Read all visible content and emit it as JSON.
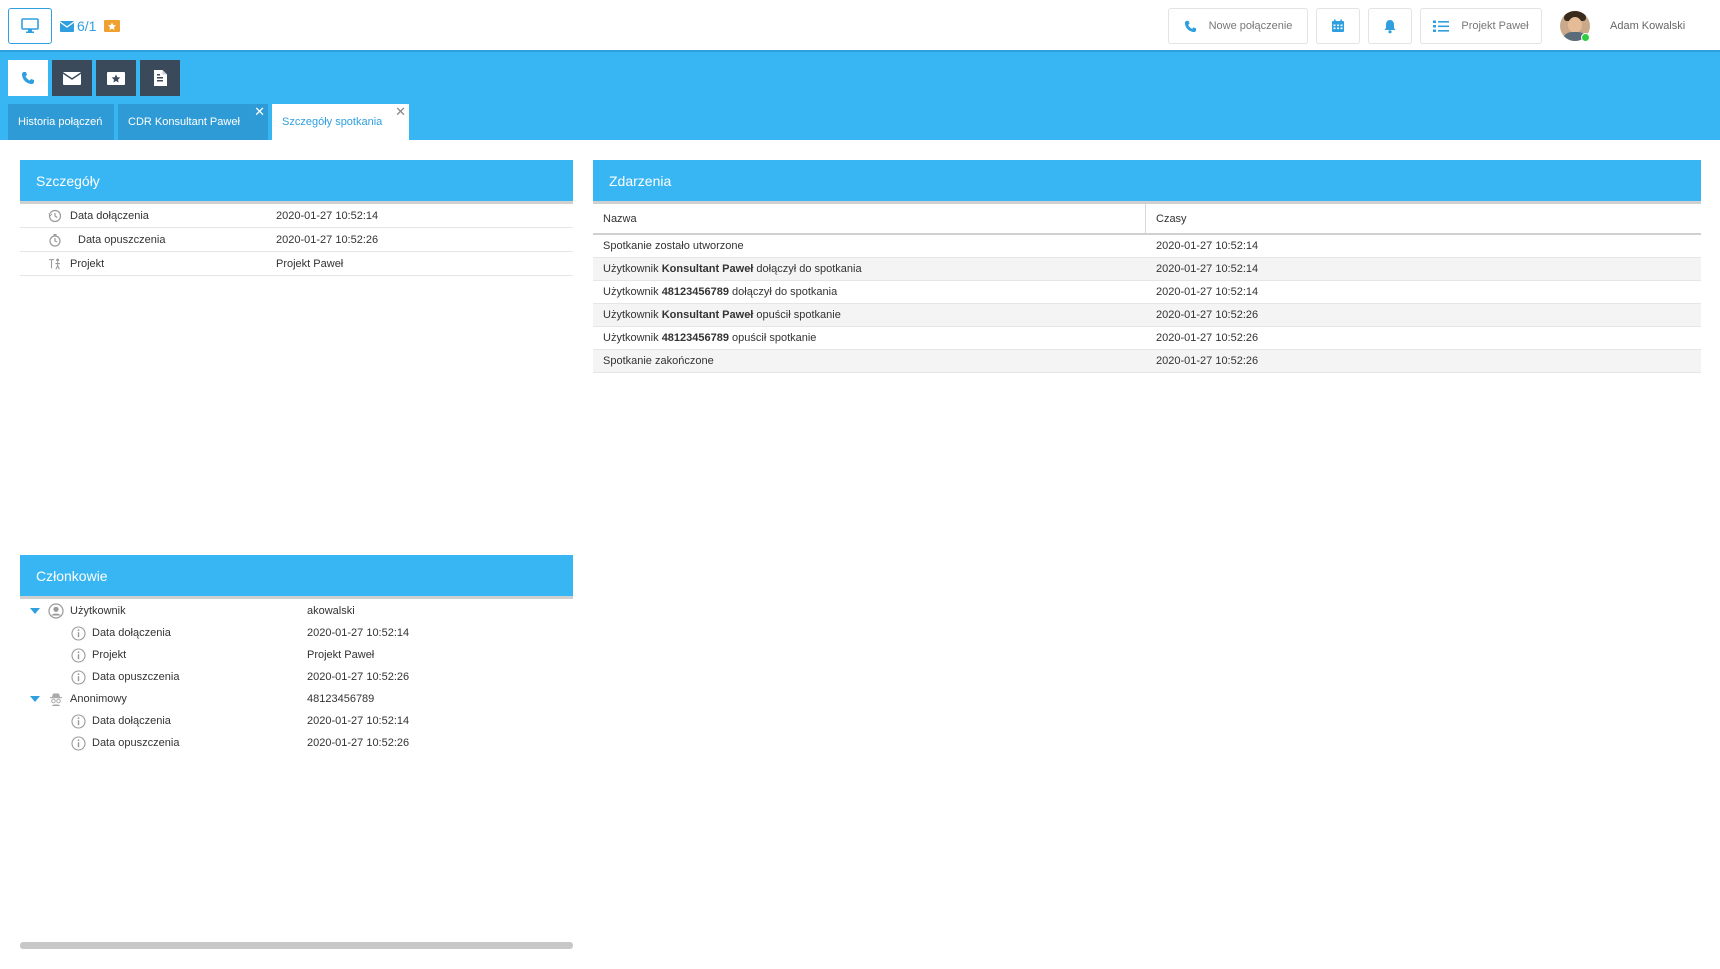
{
  "topbar": {
    "mail_count": "6/1",
    "new_call_label": "Nowe połączenie",
    "project_label": "Projekt Paweł",
    "user_name": "Adam Kowalski",
    "accent": "#2f9fe0",
    "ticket_color": "#f0a030"
  },
  "tabs": [
    {
      "label": "Historia połączeń"
    },
    {
      "label": "CDR Konsultant Paweł"
    },
    {
      "label": "Szczegóły spotkania"
    }
  ],
  "details": {
    "title": "Szczegóły",
    "rows": [
      {
        "icon": "history-icon",
        "label": "Data dołączenia",
        "value": "2020-01-27 10:52:14"
      },
      {
        "icon": "timer-icon",
        "label": "Data opuszczenia",
        "value": "2020-01-27 10:52:26"
      },
      {
        "icon": "project-icon",
        "label": "Projekt",
        "value": "Projekt Paweł"
      }
    ]
  },
  "events": {
    "title": "Zdarzenia",
    "col_name": "Nazwa",
    "col_time": "Czasy",
    "rows": [
      {
        "pre": "Spotkanie zostało utworzone",
        "bold": "",
        "post": "",
        "time": "2020-01-27 10:52:14"
      },
      {
        "pre": "Użytkownik ",
        "bold": "Konsultant Paweł",
        "post": " dołączył do spotkania",
        "time": "2020-01-27 10:52:14"
      },
      {
        "pre": "Użytkownik ",
        "bold": "48123456789",
        "post": " dołączył do spotkania",
        "time": "2020-01-27 10:52:14"
      },
      {
        "pre": "Użytkownik ",
        "bold": "Konsultant Paweł",
        "post": " opuścił spotkanie",
        "time": "2020-01-27 10:52:26"
      },
      {
        "pre": "Użytkownik ",
        "bold": "48123456789",
        "post": " opuścił spotkanie",
        "time": "2020-01-27 10:52:26"
      },
      {
        "pre": "Spotkanie zakończone",
        "bold": "",
        "post": "",
        "time": "2020-01-27 10:52:26"
      }
    ]
  },
  "members": {
    "title": "Członkowie",
    "groups": [
      {
        "label": "Użytkownik",
        "value": "akowalski",
        "icon": "user-circle-icon",
        "children": [
          {
            "label": "Data dołączenia",
            "value": "2020-01-27 10:52:14"
          },
          {
            "label": "Projekt",
            "value": "Projekt Paweł"
          },
          {
            "label": "Data opuszczenia",
            "value": "2020-01-27 10:52:26"
          }
        ]
      },
      {
        "label": "Anonimowy",
        "value": "48123456789",
        "icon": "anonymous-icon",
        "children": [
          {
            "label": "Data dołączenia",
            "value": "2020-01-27 10:52:14"
          },
          {
            "label": "Data opuszczenia",
            "value": "2020-01-27 10:52:26"
          }
        ]
      }
    ]
  }
}
